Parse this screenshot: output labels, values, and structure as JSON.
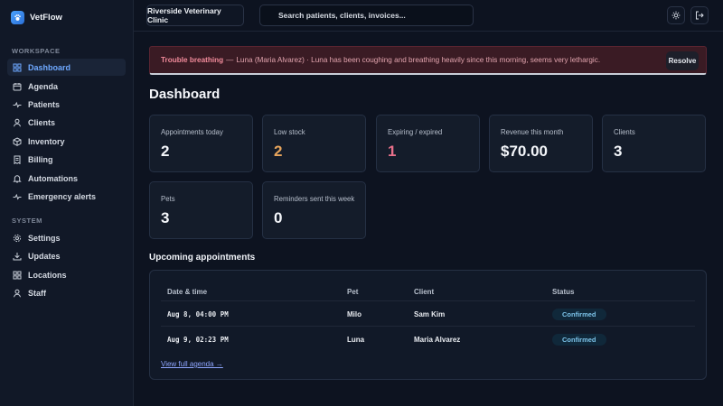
{
  "app": {
    "name": "VetFlow"
  },
  "sidebar": {
    "workspace_label": "WORKSPACE",
    "system_label": "SYSTEM",
    "workspace_items": [
      {
        "label": "Dashboard",
        "icon": "grid-icon",
        "active": true
      },
      {
        "label": "Agenda",
        "icon": "calendar-icon"
      },
      {
        "label": "Patients",
        "icon": "pulse-icon"
      },
      {
        "label": "Clients",
        "icon": "user-icon"
      },
      {
        "label": "Inventory",
        "icon": "box-icon"
      },
      {
        "label": "Billing",
        "icon": "receipt-icon"
      },
      {
        "label": "Automations",
        "icon": "bell-icon"
      },
      {
        "label": "Emergency alerts",
        "icon": "pulse-icon"
      }
    ],
    "system_items": [
      {
        "label": "Settings",
        "icon": "gear-icon"
      },
      {
        "label": "Updates",
        "icon": "download-icon"
      },
      {
        "label": "Locations",
        "icon": "grid-icon"
      },
      {
        "label": "Staff",
        "icon": "user-icon"
      }
    ]
  },
  "topbar": {
    "clinic": "Riverside Veterinary Clinic",
    "search_placeholder": "Search patients, clients, invoices..."
  },
  "alert": {
    "title": "Trouble breathing",
    "separator": "—",
    "message": "Luna (Maria Alvarez) · Luna has been coughing and breathing heavily since this morning, seems very lethargic.",
    "resolve_label": "Resolve"
  },
  "page": {
    "title": "Dashboard"
  },
  "stats": [
    {
      "label": "Appointments today",
      "value": "2",
      "color": "#f4f6fa"
    },
    {
      "label": "Low stock",
      "value": "2",
      "color": "#e8a55c"
    },
    {
      "label": "Expiring / expired",
      "value": "1",
      "color": "#e8708a"
    },
    {
      "label": "Revenue this month",
      "value": "$70.00",
      "color": "#f4f6fa"
    },
    {
      "label": "Clients",
      "value": "3",
      "color": "#f4f6fa"
    },
    {
      "label": "Pets",
      "value": "3",
      "color": "#f4f6fa"
    },
    {
      "label": "Reminders sent this week",
      "value": "0",
      "color": "#f4f6fa"
    }
  ],
  "appointments": {
    "title": "Upcoming appointments",
    "columns": [
      "Date & time",
      "Pet",
      "Client",
      "Status"
    ],
    "rows": [
      {
        "datetime": "Aug 8, 04:00 PM",
        "pet": "Milo",
        "client": "Sam Kim",
        "status": "Confirmed"
      },
      {
        "datetime": "Aug 9, 02:23 PM",
        "pet": "Luna",
        "client": "Maria Alvarez",
        "status": "Confirmed"
      }
    ],
    "link": "View full agenda →"
  },
  "colors": {
    "accent": "#6ea8ff",
    "alert_bg": "#3a1b24",
    "badge": "#7cc3e9"
  }
}
